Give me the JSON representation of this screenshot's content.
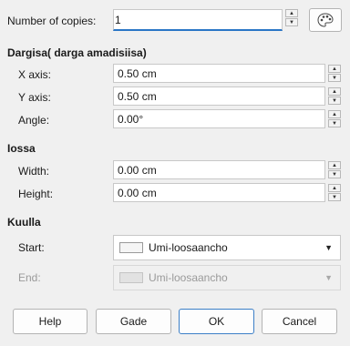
{
  "copies": {
    "label": "Number of copies:",
    "value": "1"
  },
  "placement": {
    "title": "Dargisa( darga amadisiisa)",
    "x_axis": {
      "label": "X axis:",
      "value": "0.50 cm"
    },
    "y_axis": {
      "label": "Y axis:",
      "value": "0.50 cm"
    },
    "angle": {
      "label": "Angle:",
      "value": "0.00°"
    }
  },
  "enlargement": {
    "title": "Iossa",
    "width": {
      "label": "Width:",
      "value": "0.00 cm"
    },
    "height": {
      "label": "Height:",
      "value": "0.00 cm"
    }
  },
  "colors": {
    "title": "Kuulla",
    "start": {
      "label": "Start:",
      "value": "Umi-loosaancho"
    },
    "end": {
      "label": "End:",
      "value": "Umi-loosaancho"
    }
  },
  "buttons": {
    "help": "Help",
    "reset": "Gade",
    "ok": "OK",
    "cancel": "Cancel"
  },
  "theme": {
    "accent": "#2a76c6",
    "background": "#f0f0f0"
  }
}
